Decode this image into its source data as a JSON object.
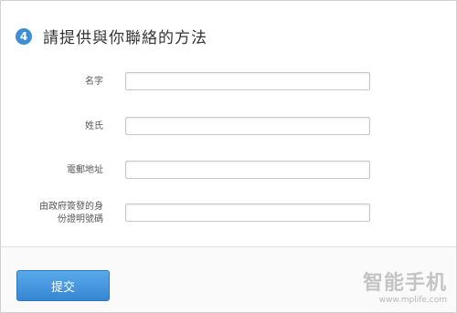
{
  "header": {
    "step_number": "4",
    "title": "請提供與你聯絡的方法"
  },
  "form": {
    "fields": [
      {
        "label": "名字",
        "value": ""
      },
      {
        "label": "姓氏",
        "value": ""
      },
      {
        "label": "電郵地址",
        "value": ""
      },
      {
        "label_line1": "由政府簽發的身",
        "label_line2": "份證明號碼",
        "value": ""
      }
    ]
  },
  "footer": {
    "submit_label": "提交"
  },
  "watermark": {
    "logo_text": "智能手机",
    "url": "www.mplife.com"
  },
  "colors": {
    "accent": "#3c8fd4",
    "button": "#3487d2"
  }
}
